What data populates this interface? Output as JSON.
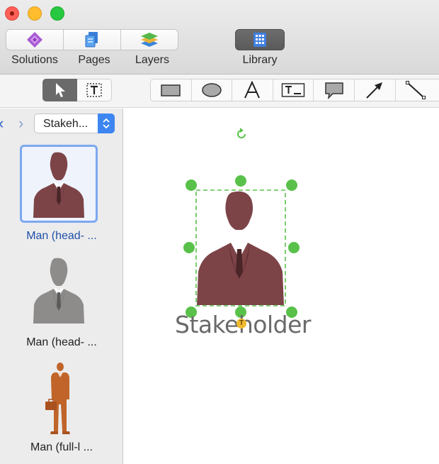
{
  "window": {
    "controls": [
      "close",
      "minimize",
      "maximize"
    ]
  },
  "toolbar": {
    "solutions_label": "Solutions",
    "pages_label": "Pages",
    "layers_label": "Layers",
    "library_label": "Library"
  },
  "tools": {
    "mode": [
      "select-arrow-icon",
      "text-box-icon"
    ],
    "shapes": [
      "rectangle-icon",
      "ellipse-icon",
      "text-icon",
      "text-field-icon",
      "callout-icon",
      "arrow-icon",
      "line-icon"
    ]
  },
  "library": {
    "selected_library": "Stakeh...",
    "items": [
      {
        "caption": "Man (head- ...",
        "icon": "man-head-shoulders-icon",
        "color": "#7d4448",
        "selected": true
      },
      {
        "caption": "Man (head- ...",
        "icon": "man-head-shoulders-icon",
        "color": "#8e8b8b",
        "selected": false
      },
      {
        "caption": "Man (full-l ...",
        "icon": "man-full-length-icon",
        "color": "#c0642a",
        "selected": false
      }
    ]
  },
  "canvas": {
    "shape_label": "Stakeholder",
    "shape_color": "#7d4448",
    "selection_color": "#59c14a",
    "text_handle_glyph": "T"
  }
}
